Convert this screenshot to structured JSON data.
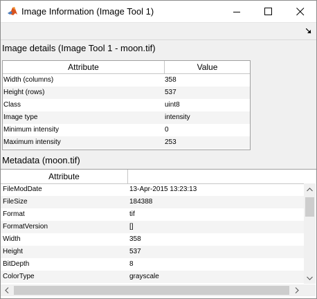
{
  "window": {
    "title": "Image Information (Image Tool 1)",
    "icon": "matlab-icon"
  },
  "image_details": {
    "title": "Image details  (Image Tool 1 - moon.tif)",
    "headers": [
      "Attribute",
      "Value"
    ],
    "rows": [
      [
        "Width (columns)",
        "358"
      ],
      [
        "Height (rows)",
        "537"
      ],
      [
        "Class",
        "uint8"
      ],
      [
        "Image type",
        "intensity"
      ],
      [
        "Minimum intensity",
        "0"
      ],
      [
        "Maximum intensity",
        "253"
      ]
    ]
  },
  "metadata": {
    "title": "Metadata (moon.tif)",
    "headers": [
      "Attribute",
      ""
    ],
    "rows": [
      [
        "FileModDate",
        "13-Apr-2015 13:23:13"
      ],
      [
        "FileSize",
        "184388"
      ],
      [
        "Format",
        "tif"
      ],
      [
        "FormatVersion",
        "[]"
      ],
      [
        "Width",
        "358"
      ],
      [
        "Height",
        "537"
      ],
      [
        "BitDepth",
        "8"
      ],
      [
        "ColorType",
        "grayscale"
      ]
    ]
  }
}
